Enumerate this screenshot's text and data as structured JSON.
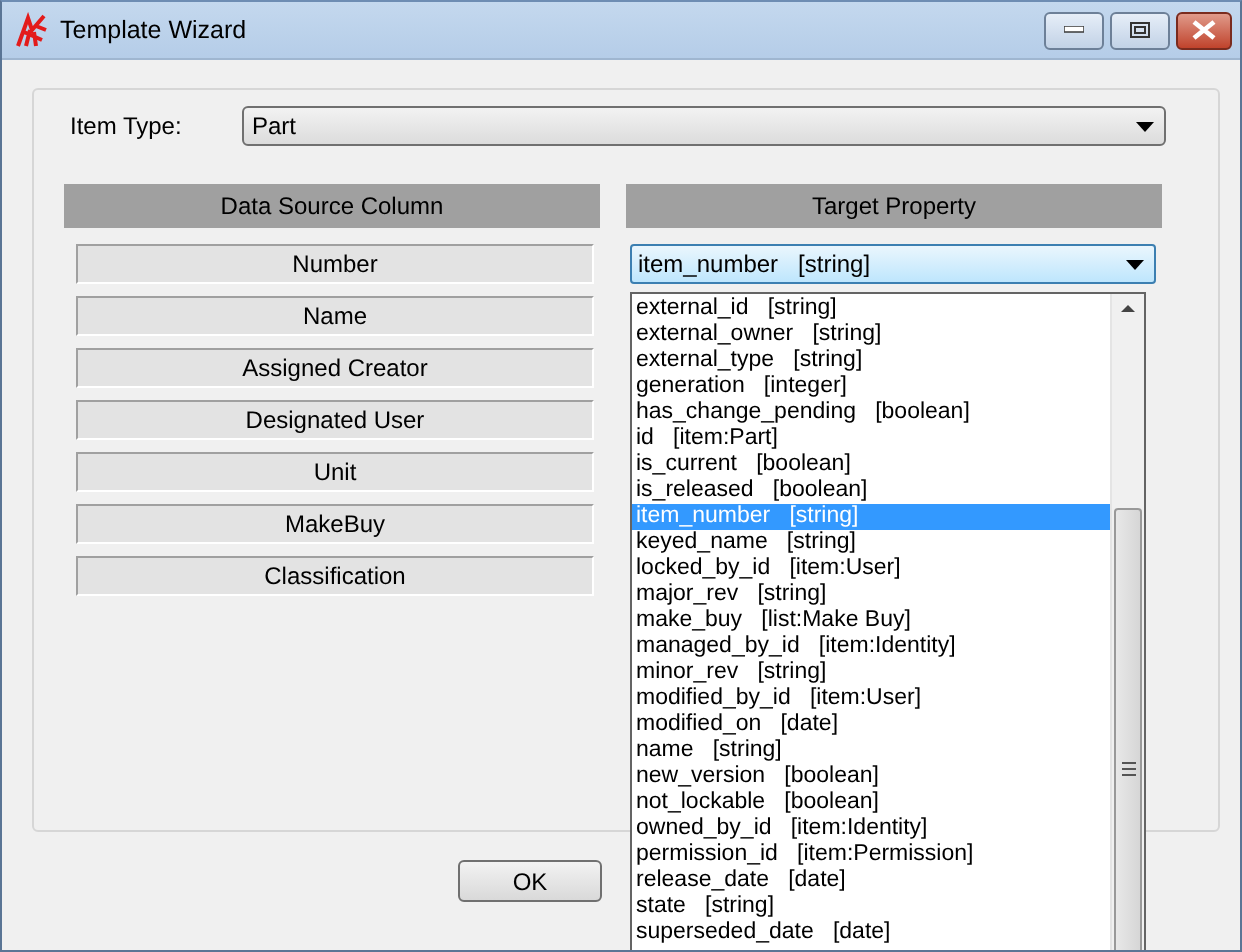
{
  "window": {
    "title": "Template Wizard"
  },
  "item_type": {
    "label": "Item Type:",
    "value": "Part"
  },
  "columns": {
    "source_header": "Data Source Column",
    "target_header": "Target Property"
  },
  "mappings": [
    {
      "source": "Number",
      "target": "item_number   [string]",
      "open": true
    },
    {
      "source": "Name"
    },
    {
      "source": "Assigned Creator"
    },
    {
      "source": "Designated User"
    },
    {
      "source": "Unit"
    },
    {
      "source": "MakeBuy"
    },
    {
      "source": "Classification"
    }
  ],
  "dropdown_items": [
    {
      "label": "external_id   [string]",
      "selected": false
    },
    {
      "label": "external_owner   [string]",
      "selected": false
    },
    {
      "label": "external_type   [string]",
      "selected": false
    },
    {
      "label": "generation   [integer]",
      "selected": false
    },
    {
      "label": "has_change_pending   [boolean]",
      "selected": false
    },
    {
      "label": "id   [item:Part]",
      "selected": false
    },
    {
      "label": "is_current   [boolean]",
      "selected": false
    },
    {
      "label": "is_released   [boolean]",
      "selected": false
    },
    {
      "label": "item_number   [string]",
      "selected": true
    },
    {
      "label": "keyed_name   [string]",
      "selected": false
    },
    {
      "label": "locked_by_id   [item:User]",
      "selected": false
    },
    {
      "label": "major_rev   [string]",
      "selected": false
    },
    {
      "label": "make_buy   [list:Make Buy]",
      "selected": false
    },
    {
      "label": "managed_by_id   [item:Identity]",
      "selected": false
    },
    {
      "label": "minor_rev   [string]",
      "selected": false
    },
    {
      "label": "modified_by_id   [item:User]",
      "selected": false
    },
    {
      "label": "modified_on   [date]",
      "selected": false
    },
    {
      "label": "name   [string]",
      "selected": false
    },
    {
      "label": "new_version   [boolean]",
      "selected": false
    },
    {
      "label": "not_lockable   [boolean]",
      "selected": false
    },
    {
      "label": "owned_by_id   [item:Identity]",
      "selected": false
    },
    {
      "label": "permission_id   [item:Permission]",
      "selected": false
    },
    {
      "label": "release_date   [date]",
      "selected": false
    },
    {
      "label": "state   [string]",
      "selected": false
    },
    {
      "label": "superseded_date   [date]",
      "selected": false
    }
  ],
  "buttons": [
    {
      "label": "OK"
    }
  ]
}
